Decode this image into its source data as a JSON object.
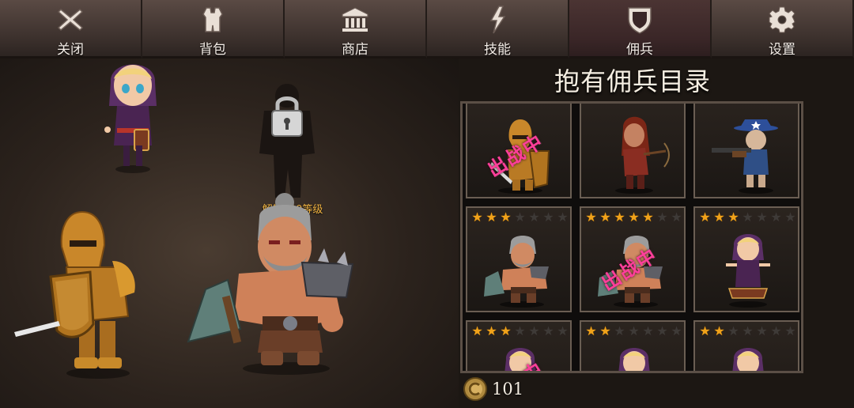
{
  "tabs": [
    {
      "label": "关闭",
      "icon": "close-icon"
    },
    {
      "label": "背包",
      "icon": "armor-icon"
    },
    {
      "label": "商店",
      "icon": "shop-icon"
    },
    {
      "label": "技能",
      "icon": "lightning-icon"
    },
    {
      "label": "佣兵",
      "icon": "shield-icon",
      "active": true
    },
    {
      "label": "设置",
      "icon": "gear-icon"
    }
  ],
  "scene": {
    "lock_label": "解锁200等级"
  },
  "roster": {
    "title": "抱有佣兵目录",
    "deployed_label": "出战中",
    "cards": [
      {
        "stars": null,
        "character": "golden-knight",
        "deployed": true
      },
      {
        "stars": null,
        "character": "red-archer",
        "deployed": false
      },
      {
        "stars": null,
        "character": "cowboy-gunner",
        "deployed": false
      },
      {
        "stars": 3,
        "character": "axe-barbarian",
        "deployed": false
      },
      {
        "stars": 5,
        "character": "axe-barbarian",
        "deployed": true
      },
      {
        "stars": 3,
        "character": "hooded-mage",
        "deployed": false
      },
      {
        "stars": 3,
        "character": "hooded-mage",
        "deployed": true
      },
      {
        "stars": 2,
        "character": "hooded-mage",
        "deployed": false
      },
      {
        "stars": 2,
        "character": "hooded-mage",
        "deployed": false
      }
    ],
    "max_stars": 7
  },
  "currency": {
    "amount": "101",
    "icon": "coin-icon"
  }
}
